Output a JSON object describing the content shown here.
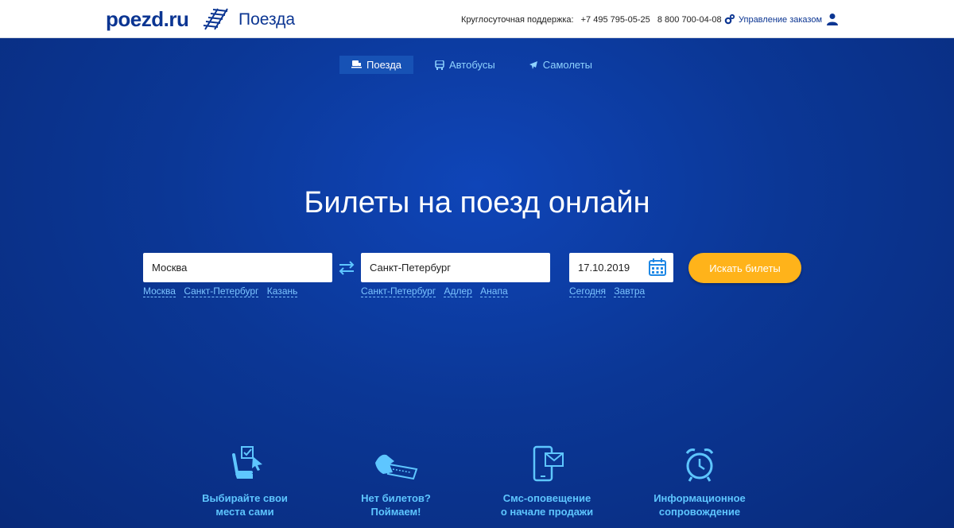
{
  "header": {
    "logo": "poezd.ru",
    "section_title": "Поезда",
    "support_label": "Круглосуточная поддержка:",
    "phone1": "+7 495 795-05-25",
    "phone2": "8 800 700-04-08",
    "manage_label": "Управление заказом"
  },
  "tabs": [
    {
      "label": "Поезда",
      "icon": "train-icon"
    },
    {
      "label": "Автобусы",
      "icon": "bus-icon"
    },
    {
      "label": "Самолеты",
      "icon": "plane-icon"
    }
  ],
  "headline": "Билеты на поезд онлайн",
  "search": {
    "from_value": "Москва",
    "to_value": "Санкт-Петербург",
    "date_value": "17.10.2019",
    "button_label": "Искать билеты",
    "from_quick": [
      "Москва",
      "Санкт-Петербург",
      "Казань"
    ],
    "to_quick": [
      "Санкт-Петербург",
      "Адлер",
      "Анапа"
    ],
    "date_quick": [
      "Сегодня",
      "Завтра"
    ]
  },
  "features": [
    {
      "line1": "Выбирайте свои",
      "line2": "места сами",
      "icon": "seat-select-icon"
    },
    {
      "line1": "Нет билетов?",
      "line2": "Поймаем!",
      "icon": "ticket-catch-icon"
    },
    {
      "line1": "Смс-оповещение",
      "line2": "о начале продажи",
      "icon": "sms-phone-icon"
    },
    {
      "line1": "Информационное",
      "line2": "сопровождение",
      "icon": "alarm-clock-icon"
    }
  ],
  "colors": {
    "brand": "#0b3592",
    "accent": "#ffb31a",
    "link": "#7cc4ff",
    "feature_text": "#5ec6ff"
  }
}
